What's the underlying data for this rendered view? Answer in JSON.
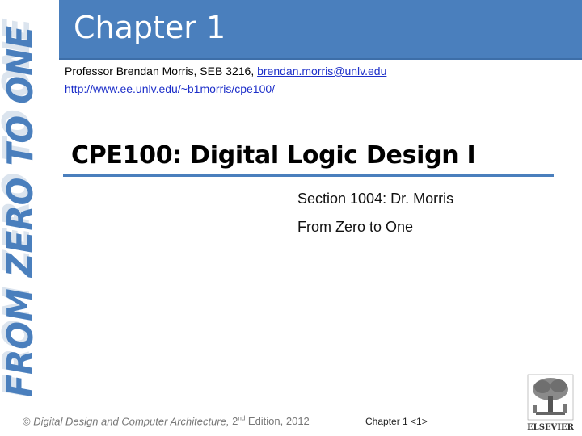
{
  "side_logo": {
    "text": "FROM ZERO TO ONE",
    "color": "#4a7fbd"
  },
  "header": {
    "title": "Chapter 1",
    "color": "#4a7fbd"
  },
  "professor": {
    "text": "Professor Brendan Morris, SEB 3216, ",
    "email": "brendan.morris@unlv.edu",
    "url": "http://www.ee.unlv.edu/~b1morris/cpe100/"
  },
  "slide": {
    "title": "CPE100: Digital Logic Design I",
    "subtitle_1": "Section 1004: Dr. Morris",
    "subtitle_2": "From Zero to One"
  },
  "footer": {
    "copyright_symbol": "©",
    "book": "Digital Design and Computer Architecture",
    "edition_num": "2",
    "edition_sup": "nd",
    "edition_rest": " Edition, 2012",
    "page": "Chapter 1 <1>"
  },
  "publisher_logo": {
    "name": "ELSEVIER"
  }
}
